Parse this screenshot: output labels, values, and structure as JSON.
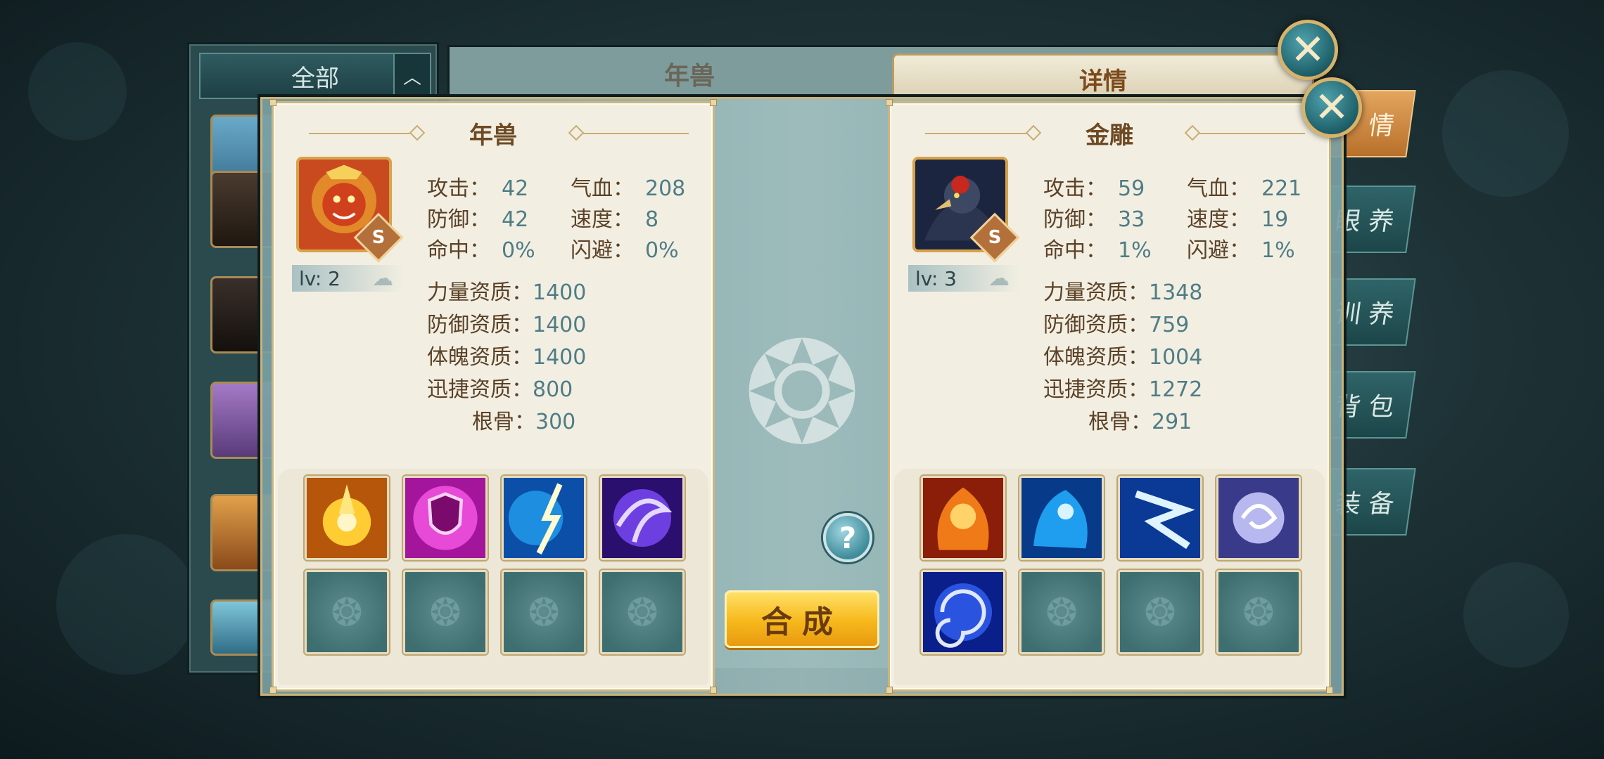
{
  "background": {
    "list_header": "全部",
    "pet_name": "年兽",
    "detail_tab": "详情",
    "side_tabs": [
      "情",
      "眼 养",
      "训 养",
      "背 包",
      "装 备"
    ]
  },
  "left_pet": {
    "name": "年兽",
    "grade": "S",
    "level": "lv: 2",
    "stats": {
      "attack_label": "攻击：",
      "attack": "42",
      "hp_label": "气血：",
      "hp": "208",
      "defense_label": "防御：",
      "defense": "42",
      "speed_label": "速度：",
      "speed": "8",
      "hit_label": "命中：",
      "hit": "0%",
      "dodge_label": "闪避：",
      "dodge": "0%"
    },
    "aptitudes": {
      "strength_label": "力量资质：",
      "strength": "1400",
      "defense_label": "防御资质：",
      "defense": "1400",
      "physique_label": "体魄资质：",
      "physique": "1400",
      "agility_label": "迅捷资质：",
      "agility": "800",
      "bone_label": "根骨：",
      "bone": "300"
    },
    "skills": [
      "golden-burst-icon",
      "pink-shield-icon",
      "blue-lightning-icon",
      "purple-vortex-icon"
    ]
  },
  "right_pet": {
    "name": "金雕",
    "grade": "S",
    "level": "lv: 3",
    "stats": {
      "attack_label": "攻击：",
      "attack": "59",
      "hp_label": "气血：",
      "hp": "221",
      "defense_label": "防御：",
      "defense": "33",
      "speed_label": "速度：",
      "speed": "19",
      "hit_label": "命中：",
      "hit": "1%",
      "dodge_label": "闪避：",
      "dodge": "1%"
    },
    "aptitudes": {
      "strength_label": "力量资质：",
      "strength": "1348",
      "defense_label": "防御资质：",
      "defense": "759",
      "physique_label": "体魄资质：",
      "physique": "1004",
      "agility_label": "迅捷资质：",
      "agility": "1272",
      "bone_label": "根骨：",
      "bone": "291"
    },
    "skills": [
      "fire-beast-icon",
      "ice-beast-icon",
      "ice-lightning-icon",
      "wind-orb-icon",
      "blue-whirlpool-icon"
    ]
  },
  "buttons": {
    "merge": "合成",
    "help": "?"
  },
  "colors": {
    "stat_value": "#4f7c86",
    "stat_label": "#5b4127",
    "merge_button": "#f6b81b",
    "accent_gold": "#cdb581"
  }
}
